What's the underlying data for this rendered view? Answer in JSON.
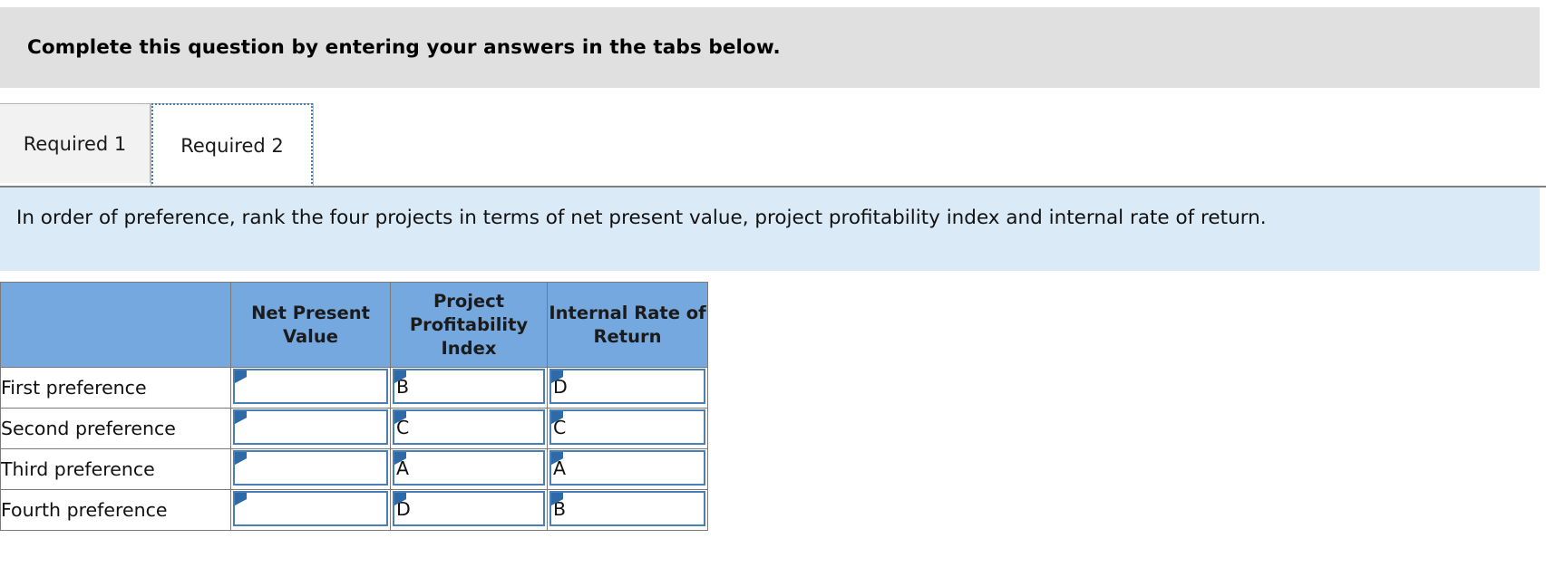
{
  "banner": {
    "text": "Complete this question by entering your answers in the tabs below."
  },
  "tabs": [
    {
      "label": "Required 1",
      "active": false
    },
    {
      "label": "Required 2",
      "active": true
    }
  ],
  "instruction": {
    "text": "In order of preference, rank the four projects in terms of net present value, project profitability index and internal rate of return."
  },
  "table": {
    "corner_header": "",
    "columns": [
      "Net Present Value",
      "Project Profitability Index",
      "Internal Rate of Return"
    ],
    "rows": [
      {
        "label": "First preference",
        "net_present_value": "",
        "project_profitability_index": "B",
        "internal_rate_of_return": "D"
      },
      {
        "label": "Second preference",
        "net_present_value": "",
        "project_profitability_index": "C",
        "internal_rate_of_return": "C"
      },
      {
        "label": "Third preference",
        "net_present_value": "",
        "project_profitability_index": "A",
        "internal_rate_of_return": "A"
      },
      {
        "label": "Fourth preference",
        "net_present_value": "",
        "project_profitability_index": "D",
        "internal_rate_of_return": "B"
      }
    ]
  },
  "colors": {
    "banner_bg": "#e0e0e0",
    "instruction_bg": "#daeaf7",
    "table_header_bg": "#75a8de",
    "input_border": "#4a7fb5",
    "focus_ring": "#3f7cc0",
    "marker": "#2e6aa8"
  }
}
